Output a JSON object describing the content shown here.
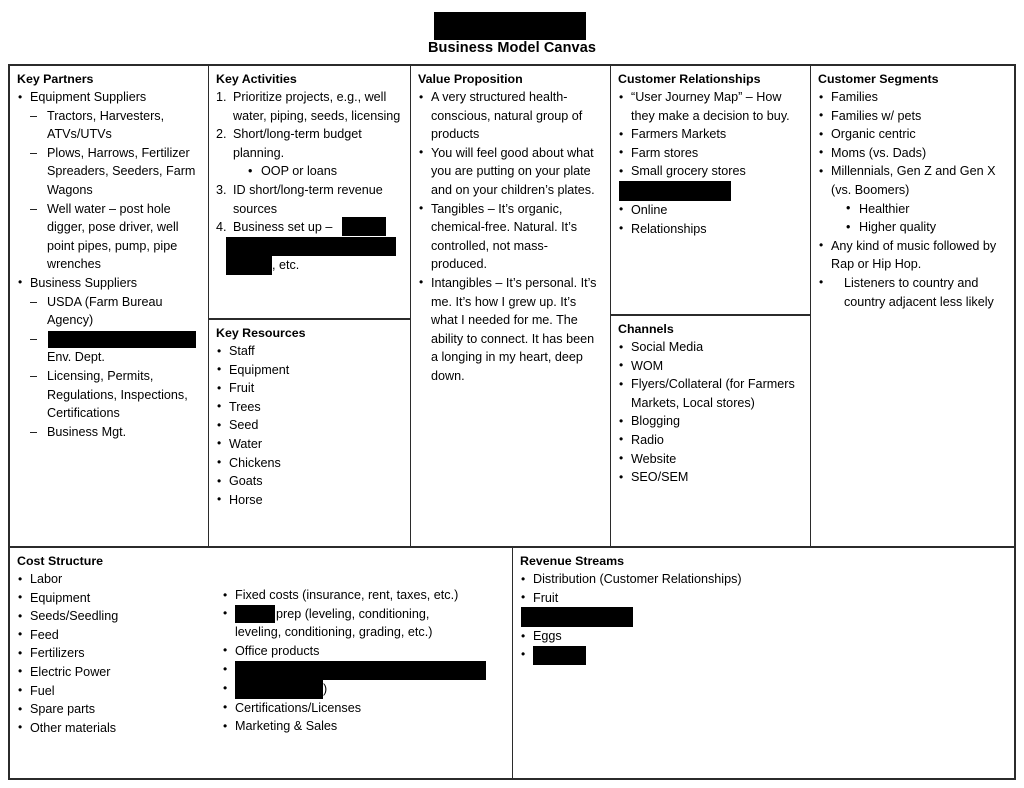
{
  "document": {
    "title": "Business Model Canvas",
    "title_redacted": true
  },
  "colors": {
    "redaction": "#000000",
    "border": "#2b2b2b",
    "text": "#000000",
    "background": "#ffffff"
  },
  "blocks": {
    "key_partners": {
      "title": "Key Partners",
      "items": [
        {
          "text": "Equipment Suppliers",
          "children": [
            "Tractors, Harvesters, ATVs/UTVs",
            "Plows, Harrows, Fertilizer Spreaders, Seeders, Farm Wagons",
            "Well water – post hole digger, pose driver, well point pipes, pump, pipe wrenches"
          ]
        },
        {
          "text": "Business Suppliers",
          "children": [
            "USDA (Farm Bureau Agency)",
            "[REDACTED] Env. Dept.",
            "Licensing, Permits, Regulations, Inspections, Certifications",
            "Business Mgt."
          ]
        }
      ]
    },
    "key_activities": {
      "title": "Key Activities",
      "items": [
        {
          "text": "Prioritize projects, e.g., well water, piping, seeds, licensing",
          "children": []
        },
        {
          "text": "Short/long-term budget planning.",
          "children": [
            "OOP or loans"
          ]
        },
        {
          "text": "ID short/long-term revenue sources",
          "children": []
        },
        {
          "text": "Business set up – [REDACTED], etc.",
          "children": []
        }
      ]
    },
    "key_resources": {
      "title": "Key Resources",
      "items": [
        "Staff",
        "Equipment",
        "Fruit",
        "Trees",
        "Seed",
        "Water",
        "Chickens",
        "Goats",
        "Horse"
      ]
    },
    "value_proposition": {
      "title": "Value Proposition",
      "items": [
        "A very structured health-conscious, natural group of products",
        "You will feel good about what you are putting on your plate and on your children’s plates.",
        "Tangibles – It’s organic, chemical-free. Natural. It’s controlled, not mass-produced.",
        "Intangibles – It’s personal. It’s me. It’s how I grew up. It’s what I needed for me. The ability to connect. It has been a longing in my heart, deep down."
      ]
    },
    "customer_relationships": {
      "title": "Customer Relationships",
      "items": [
        "“User Journey Map” – How they make a decision to buy.",
        "Farmers Markets",
        "Farm stores",
        "Small grocery stores",
        "[REDACTED]",
        "Online",
        "Relationships"
      ]
    },
    "channels": {
      "title": "Channels",
      "items": [
        "Social Media",
        "WOM",
        "Flyers/Collateral (for Farmers Markets, Local stores)",
        "Blogging",
        "Radio",
        "Website",
        "SEO/SEM"
      ]
    },
    "customer_segments": {
      "title": "Customer Segments",
      "items": [
        {
          "text": "Families",
          "children": []
        },
        {
          "text": "Families w/ pets",
          "children": []
        },
        {
          "text": "Organic centric",
          "children": []
        },
        {
          "text": "Moms (vs. Dads)",
          "children": []
        },
        {
          "text": "Millennials, Gen Z and Gen X (vs. Boomers)",
          "children": [
            "Healthier",
            "Higher quality"
          ]
        },
        {
          "text": "Any kind of music followed by Rap or Hip Hop.",
          "children": []
        },
        {
          "text": "Listeners to country and country adjacent less likely",
          "children": []
        }
      ]
    },
    "cost_structure": {
      "title": "Cost Structure",
      "column_left": [
        "Labor",
        "Equipment",
        "Seeds/Seedling",
        "Feed",
        "Fertilizers",
        "Electric Power",
        "Fuel",
        "Spare parts",
        "Other materials"
      ],
      "column_right": [
        "Fixed costs (insurance, rent, taxes, etc.)",
        "[REDACTED] prep (leveling, conditioning, leveling, conditioning, grading, etc.)",
        "Office products",
        "[REDACTED]",
        "[REDACTED])",
        "Certifications/Licenses",
        "Marketing & Sales"
      ]
    },
    "revenue_streams": {
      "title": "Revenue Streams",
      "items": [
        "Distribution (Customer Relationships)",
        "Fruit",
        "[REDACTED]",
        "Eggs",
        "[REDACTED]"
      ]
    }
  },
  "fragments": {
    "etc_suffix": ", etc.",
    "business_set_up_prefix": "Business set up –",
    "prep_suffix": "prep (leveling, conditioning,",
    "prep_line2": "leveling, conditioning, grading, etc.)",
    "env_dept": "Env. Dept.",
    "paren_close": ")"
  }
}
